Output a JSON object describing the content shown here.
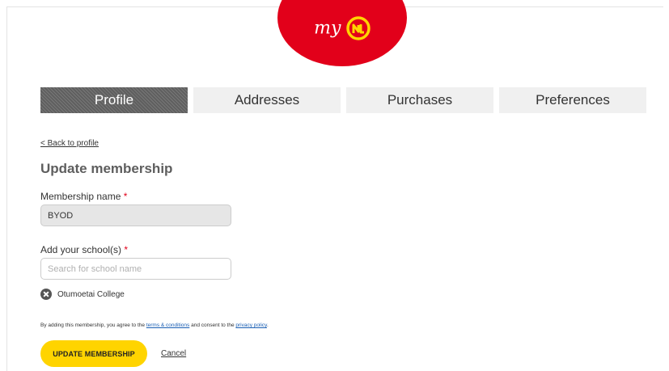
{
  "brand": {
    "logo_text": "my",
    "logo_mark": "nl",
    "color": "#e2001a",
    "accent": "#ffd400"
  },
  "tabs": [
    {
      "label": "Profile",
      "active": true
    },
    {
      "label": "Addresses",
      "active": false
    },
    {
      "label": "Purchases",
      "active": false
    },
    {
      "label": "Preferences",
      "active": false
    }
  ],
  "back_link": "< Back to profile",
  "page_title": "Update membership",
  "membership_name": {
    "label": "Membership name",
    "required_marker": "*",
    "value": "BYOD"
  },
  "schools": {
    "label": "Add your school(s)",
    "required_marker": "*",
    "placeholder": "Search for school name",
    "selected": [
      {
        "name": "Otumoetai College",
        "remove_icon": "close-circle-icon"
      }
    ]
  },
  "terms": {
    "prefix": "By adding this membership, you agree to the",
    "terms_link": "terms & conditions",
    "middle": "and consent to the",
    "privacy_link": "privacy policy",
    "suffix": "."
  },
  "actions": {
    "update_label": "UPDATE MEMBERSHIP",
    "cancel_label": "Cancel"
  }
}
